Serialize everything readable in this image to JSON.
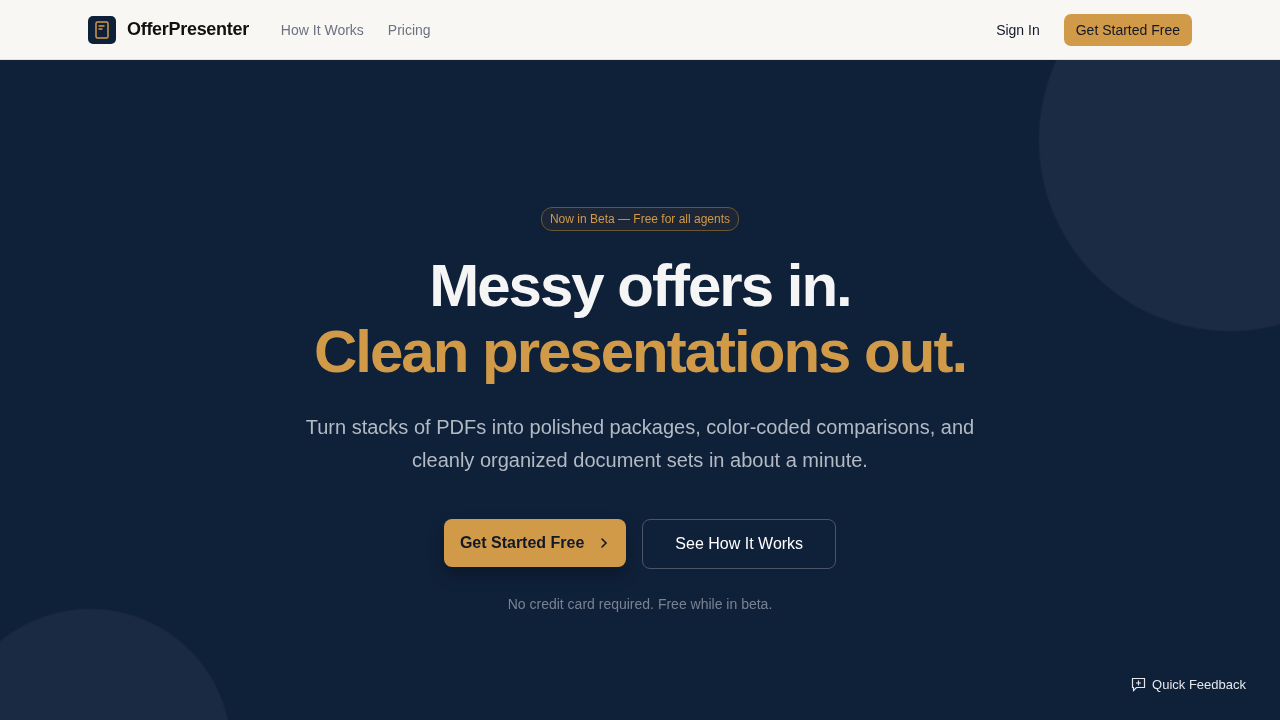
{
  "header": {
    "brand": "OfferPresenter",
    "nav": [
      "How It Works",
      "Pricing"
    ],
    "sign_in": "Sign In",
    "cta": "Get Started Free"
  },
  "hero": {
    "badge": "Now in Beta — Free for all agents",
    "headline_line_1": "Messy offers in.",
    "headline_line_2": "Clean presentations out.",
    "subtitle": "Turn stacks of PDFs into polished packages, color-coded comparisons, and cleanly organized document sets in about a minute.",
    "primary_button": "Get Started Free",
    "secondary_button": "See How It Works",
    "note": "No credit card required. Free while in beta."
  },
  "feedback": {
    "label": "Quick Feedback"
  }
}
